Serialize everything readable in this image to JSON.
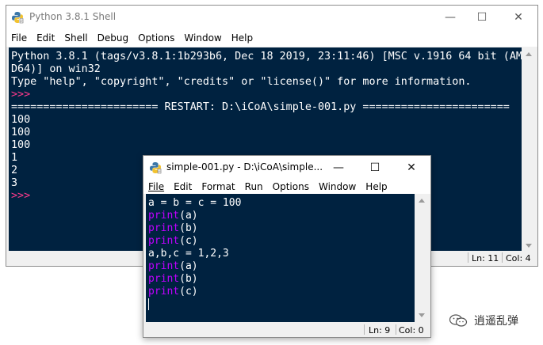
{
  "shell": {
    "title": "Python 3.8.1 Shell",
    "menu": [
      "File",
      "Edit",
      "Shell",
      "Debug",
      "Options",
      "Window",
      "Help"
    ],
    "lines": [
      {
        "style": "stdout",
        "text": "Python 3.8.1 (tags/v3.8.1:1b293b6, Dec 18 2019, 23:11:46) [MSC v.1916 64 bit (AM"
      },
      {
        "style": "stdout",
        "text": "D64)] on win32"
      },
      {
        "style": "stdout",
        "text": "Type \"help\", \"copyright\", \"credits\" or \"license()\" for more information."
      },
      {
        "style": "prompt",
        "text": ">>> "
      },
      {
        "style": "stdout",
        "text": "======================= RESTART: D:\\iCoA\\simple-001.py ======================="
      },
      {
        "style": "stdout",
        "text": "100"
      },
      {
        "style": "stdout",
        "text": "100"
      },
      {
        "style": "stdout",
        "text": "100"
      },
      {
        "style": "stdout",
        "text": "1"
      },
      {
        "style": "stdout",
        "text": "2"
      },
      {
        "style": "stdout",
        "text": "3"
      },
      {
        "style": "prompt",
        "text": ">>> "
      }
    ],
    "status": {
      "line": "Ln: 11",
      "col": "Col: 4"
    }
  },
  "editor": {
    "title": "simple-001.py - D:\\iCoA\\simple...",
    "menu": [
      "File",
      "Edit",
      "Format",
      "Run",
      "Options",
      "Window",
      "Help"
    ],
    "code": [
      {
        "kw": "",
        "rest": "a = b = c = 100"
      },
      {
        "kw": "print",
        "rest": "(a)"
      },
      {
        "kw": "print",
        "rest": "(b)"
      },
      {
        "kw": "print",
        "rest": "(c)"
      },
      {
        "kw": "",
        "rest": "a,b,c = 1,2,3"
      },
      {
        "kw": "print",
        "rest": "(a)"
      },
      {
        "kw": "print",
        "rest": "(b)"
      },
      {
        "kw": "print",
        "rest": "(c)"
      }
    ],
    "status": {
      "line": "Ln: 9",
      "col": "Col: 0"
    }
  },
  "window_controls": {
    "minimize": "—",
    "maximize": "☐",
    "close": "✕"
  },
  "watermark": {
    "text": "逍遥乱弹"
  },
  "colors": {
    "background": "#002240",
    "prompt": "#ff3a8c",
    "keyword": "#c000ff",
    "text": "#ffffff"
  }
}
